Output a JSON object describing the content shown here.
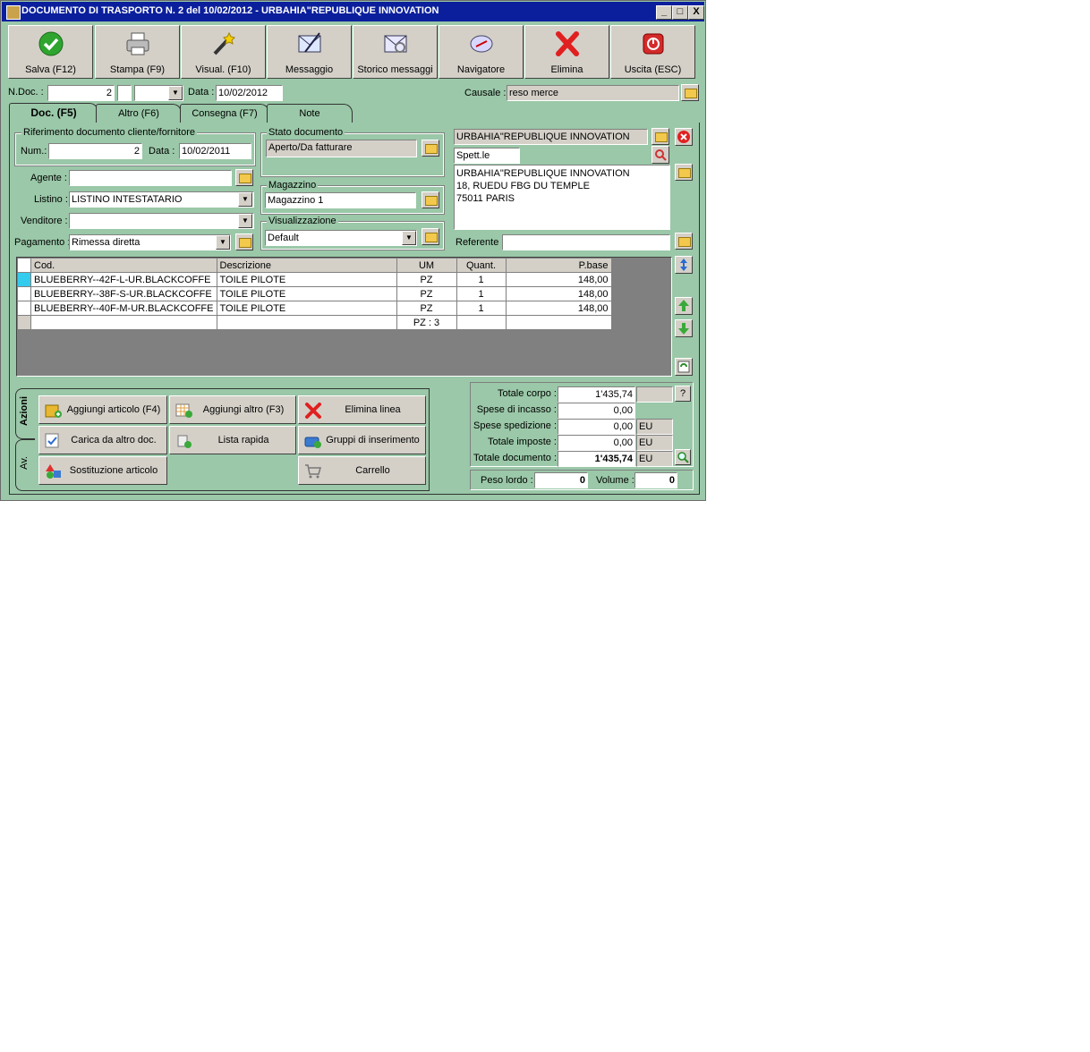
{
  "window": {
    "title": "DOCUMENTO DI TRASPORTO N. 2  del 10/02/2012 - URBAHIA\"REPUBLIQUE INNOVATION",
    "controls": [
      "_",
      "□",
      "X"
    ]
  },
  "toolbar": {
    "save": "Salva (F12)",
    "print": "Stampa (F9)",
    "view": "Visual. (F10)",
    "message": "Messaggio",
    "message_history": "Storico messaggi",
    "navigator": "Navigatore",
    "delete": "Elimina",
    "exit": "Uscita (ESC)"
  },
  "header": {
    "ndoc_label": "N.Doc. :",
    "ndoc_value": "2",
    "date_label": "Data :",
    "date_value": "10/02/2012",
    "causale_label": "Causale :",
    "causale_value": "reso merce"
  },
  "tabs": [
    "Doc. (F5)",
    "Altro (F6)",
    "Consegna (F7)",
    "Note"
  ],
  "riferimento": {
    "title": "Riferimento documento cliente/fornitore",
    "num_label": "Num.:",
    "num_value": "2",
    "data_label": "Data :",
    "data_value": "10/02/2011"
  },
  "fields": {
    "agente_label": "Agente :",
    "agente_value": "",
    "listino_label": "Listino :",
    "listino_value": "LISTINO INTESTATARIO",
    "venditore_label": "Venditore :",
    "venditore_value": "",
    "pagamento_label": "Pagamento :",
    "pagamento_value": "Rimessa diretta"
  },
  "stato": {
    "title": "Stato documento",
    "value": "Aperto/Da fatturare"
  },
  "magazzino": {
    "title": "Magazzino",
    "value": "Magazzino 1"
  },
  "visualizzazione": {
    "title": "Visualizzazione",
    "value": "Default"
  },
  "customer": {
    "name": "URBAHIA\"REPUBLIQUE INNOVATION",
    "salutation": "Spett.le",
    "address": [
      "URBAHIA\"REPUBLIQUE INNOVATION",
      "18, RUEDU FBG DU TEMPLE",
      "75011 PARIS"
    ],
    "referente_label": "Referente",
    "referente_value": ""
  },
  "grid": {
    "columns": [
      "Cod.",
      "Descrizione",
      "UM",
      "Quant.",
      "P.base"
    ],
    "rows": [
      [
        "BLUEBERRY--42F-L-UR.BLACKCOFFE",
        "TOILE PILOTE",
        "PZ",
        "1",
        "148,00"
      ],
      [
        "BLUEBERRY--38F-S-UR.BLACKCOFFE",
        "TOILE PILOTE",
        "PZ",
        "1",
        "148,00"
      ],
      [
        "BLUEBERRY--40F-M-UR.BLACKCOFFE",
        "TOILE PILOTE",
        "PZ",
        "1",
        "148,00"
      ]
    ],
    "summary": "PZ : 3"
  },
  "side_tabs": [
    "Azioni",
    "Av."
  ],
  "actions": {
    "add_article": "Aggiungi articolo (F4)",
    "add_other": "Aggiungi altro (F3)",
    "delete_line": "Elimina linea",
    "load_from_doc": "Carica da altro doc.",
    "quick_list": "Lista rapida",
    "insert_groups": "Gruppi di inserimento",
    "replace_article": "Sostituzione articolo",
    "cart": "Carrello"
  },
  "totals": {
    "totale_corpo_label": "Totale corpo :",
    "totale_corpo": "1'435,74",
    "spese_incasso_label": "Spese di incasso :",
    "spese_incasso": "0,00",
    "spese_spedizione_label": "Spese spedizione :",
    "spese_spedizione": "0,00",
    "totale_imposte_label": "Totale imposte :",
    "totale_imposte": "0,00",
    "totale_documento_label": "Totale documento :",
    "totale_documento": "1'435,74",
    "currency": "EU",
    "help": "?",
    "peso_label": "Peso lordo :",
    "peso": "0",
    "volume_label": "Volume :",
    "volume": "0"
  },
  "colors": {
    "window_bg": "#9ac8a8",
    "title_bg": "#0b1f9c",
    "selected_row": "#33ccee"
  }
}
